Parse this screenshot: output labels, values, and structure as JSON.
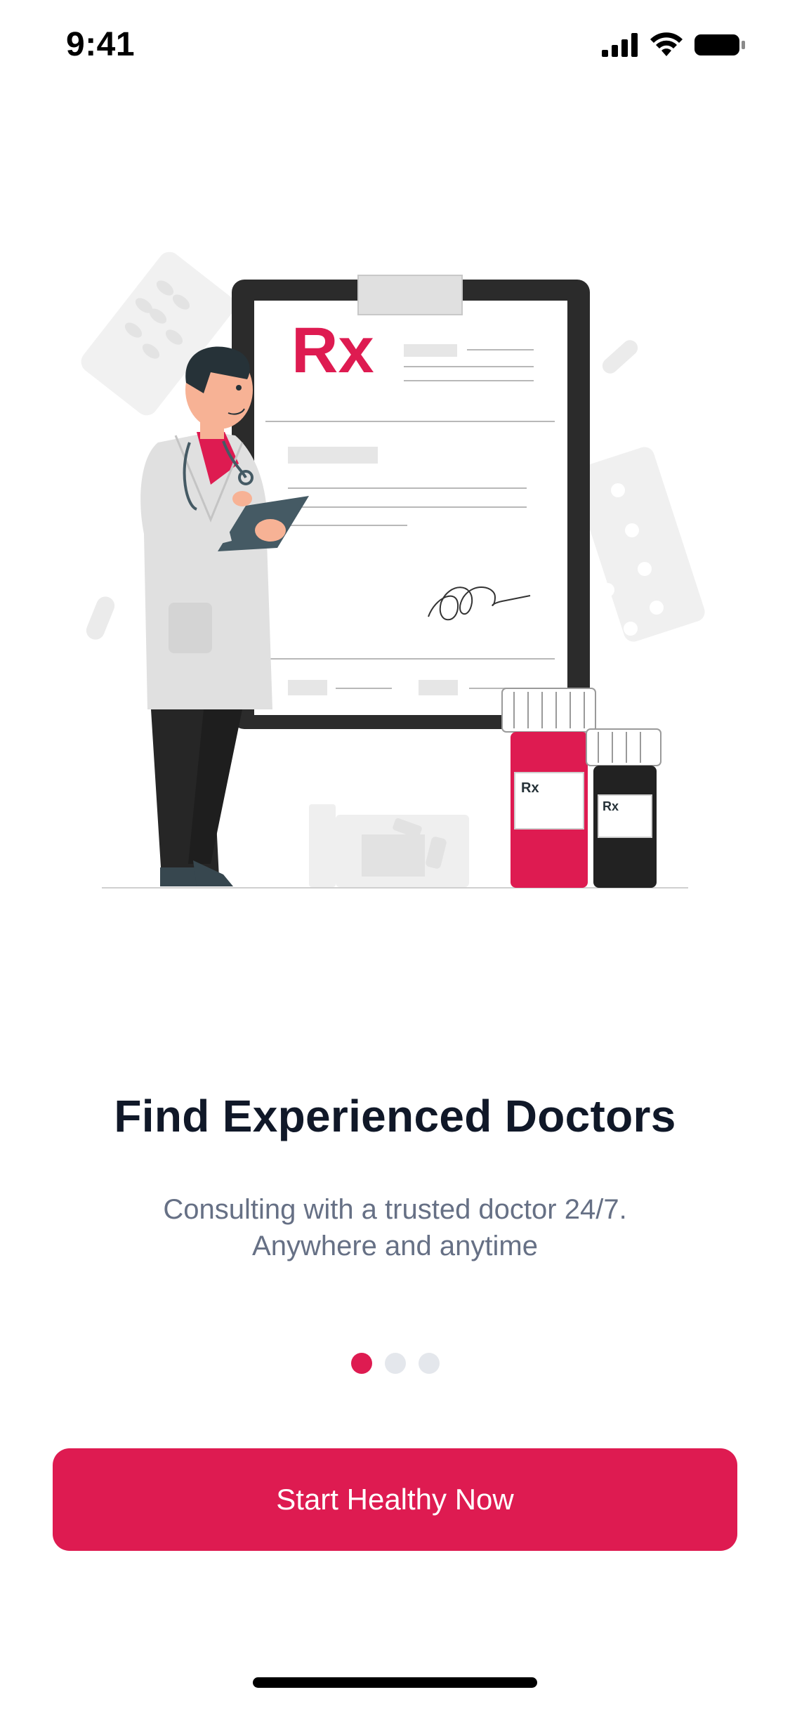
{
  "status_bar": {
    "time": "9:41",
    "icons": [
      "cellular-signal-icon",
      "wifi-icon",
      "battery-icon"
    ]
  },
  "illustration": {
    "prescription_symbol": "Rx",
    "bottle_labels": [
      "Rx",
      "Rx"
    ],
    "name": "doctor-writing-prescription-illustration"
  },
  "onboarding": {
    "title": "Find Experienced Doctors",
    "subtitle_line1": "Consulting with a trusted doctor 24/7.",
    "subtitle_line2": "Anywhere and anytime",
    "page_indicator": {
      "total": 3,
      "active": 1
    },
    "cta_label": "Start Healthy Now"
  },
  "colors": {
    "accent": "#DE1B51",
    "title": "#101828",
    "subtitle": "#667085",
    "inactive_dot": "#E4E7EC"
  }
}
